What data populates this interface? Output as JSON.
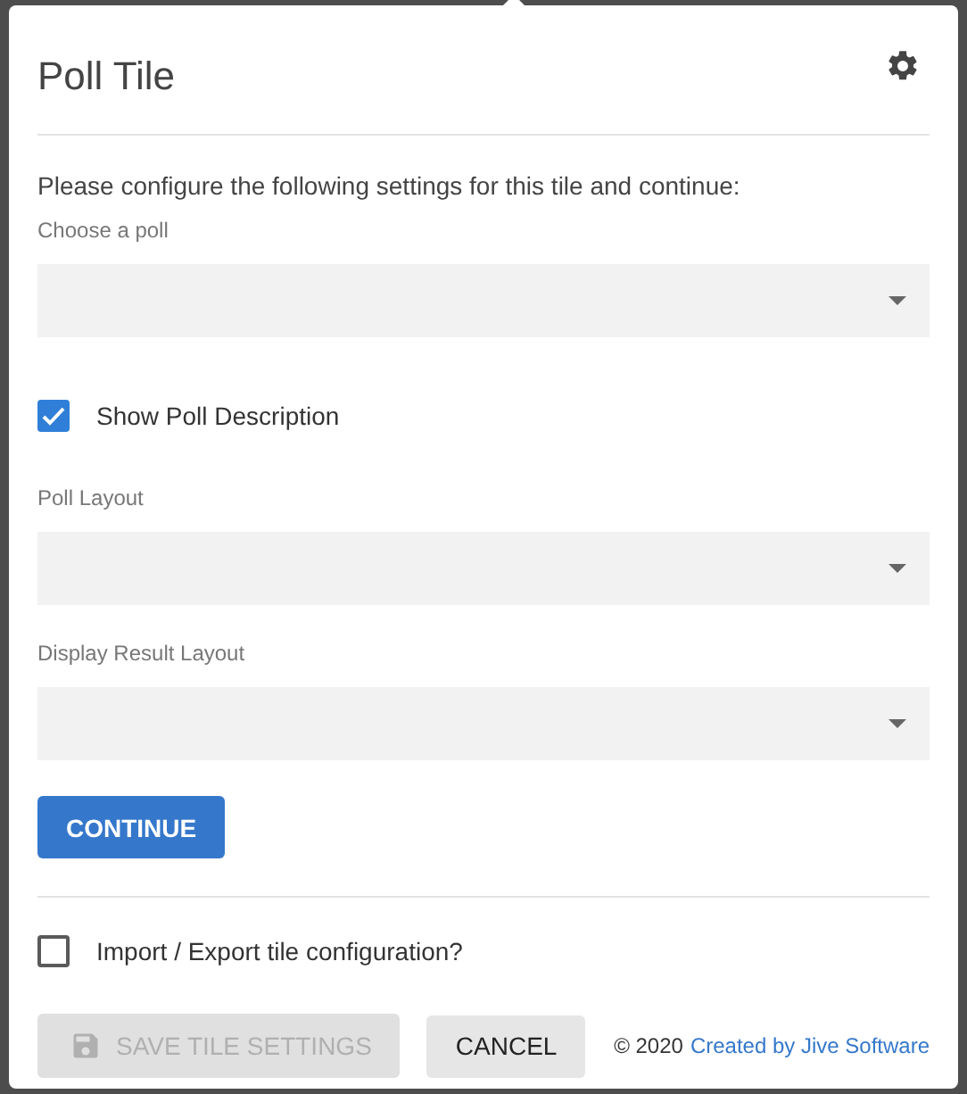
{
  "title": "Poll Tile",
  "intro": "Please configure the following settings for this tile and continue:",
  "fields": [
    {
      "kind": "select",
      "label": "Choose a poll"
    },
    {
      "kind": "checkbox",
      "label": "Show Poll Description",
      "checked": true
    },
    {
      "kind": "select",
      "label": "Poll Layout"
    },
    {
      "kind": "select",
      "label": "Display Result Layout"
    }
  ],
  "continue_button": "CONTINUE",
  "import_export": {
    "label": "Import / Export tile configuration?",
    "checked": false
  },
  "footer": {
    "save_button": {
      "label": "SAVE TILE SETTINGS",
      "disabled": true
    },
    "cancel_button": "CANCEL",
    "copyright": "© 2020",
    "link": "Created by Jive Software"
  }
}
